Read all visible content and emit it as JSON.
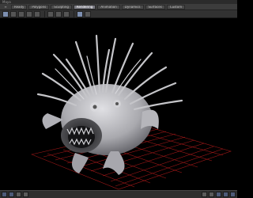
{
  "window": {
    "title": "Maya"
  },
  "tabs": [
    {
      "label": "Ready"
    },
    {
      "label": "Polygons"
    },
    {
      "label": "Sculpting"
    },
    {
      "label": "Rendering"
    },
    {
      "label": "Animation"
    },
    {
      "label": "Dynamics"
    },
    {
      "label": "Surfaces"
    },
    {
      "label": "Custom"
    }
  ],
  "active_tab_index": 3,
  "viewport": {
    "subject": "spiky creature sculpt",
    "background_color": "#000000",
    "grid_color": "#a01818",
    "model_color": "#b9b9bd"
  },
  "toolbar_icons": [
    "select-tool",
    "lasso-tool",
    "move-tool",
    "rotate-tool",
    "scale-tool",
    "sculpt-brush",
    "smooth-brush",
    "grab-brush",
    "render-button",
    "ipr-button"
  ],
  "status_icons": [
    "layout-single",
    "layout-four",
    "layout-outliner",
    "render-view",
    "script-editor",
    "attribute-editor",
    "tool-settings",
    "channel-box",
    "help"
  ]
}
